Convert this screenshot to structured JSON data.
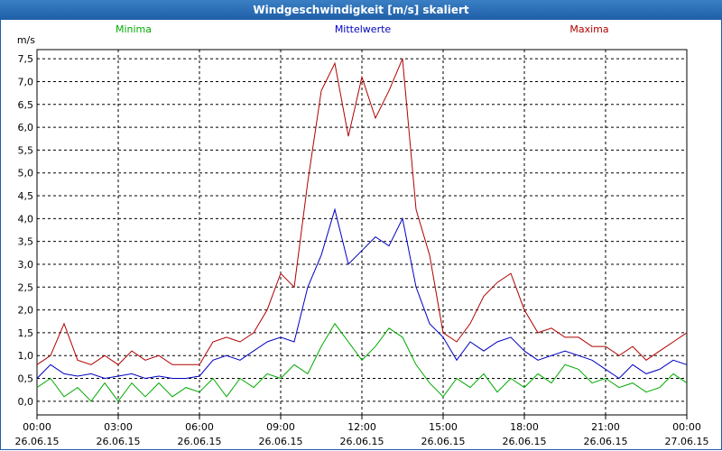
{
  "window": {
    "title": "Windgeschwindigkeit [m/s] skaliert"
  },
  "chart_data": {
    "type": "line",
    "title": "Windgeschwindigkeit [m/s] skaliert",
    "ylabel": "m/s",
    "xlabel": "",
    "ylim": [
      -0.3,
      7.7
    ],
    "xlim": [
      0,
      24
    ],
    "grid": true,
    "legend_position": "top",
    "y_ticks": [
      "0,0",
      "0,5",
      "1,0",
      "1,5",
      "2,0",
      "2,5",
      "3,0",
      "3,5",
      "4,0",
      "4,5",
      "5,0",
      "5,5",
      "6,0",
      "6,5",
      "7,0",
      "7,5"
    ],
    "y_tick_values": [
      0,
      0.5,
      1,
      1.5,
      2,
      2.5,
      3,
      3.5,
      4,
      4.5,
      5,
      5.5,
      6,
      6.5,
      7,
      7.5
    ],
    "x_ticks": [
      {
        "time": "00:00",
        "date": "26.06.15"
      },
      {
        "time": "03:00",
        "date": "26.06.15"
      },
      {
        "time": "06:00",
        "date": "26.06.15"
      },
      {
        "time": "09:00",
        "date": "26.06.15"
      },
      {
        "time": "12:00",
        "date": "26.06.15"
      },
      {
        "time": "15:00",
        "date": "26.06.15"
      },
      {
        "time": "18:00",
        "date": "26.06.15"
      },
      {
        "time": "21:00",
        "date": "26.06.15"
      },
      {
        "time": "00:00",
        "date": "27.06.15"
      }
    ],
    "x_tick_values": [
      0,
      3,
      6,
      9,
      12,
      15,
      18,
      21,
      24
    ],
    "x_unit": "hours",
    "series": [
      {
        "name": "Minima",
        "color": "#00aa00",
        "x": [
          0,
          0.5,
          1,
          1.5,
          2,
          2.5,
          3,
          3.5,
          4,
          4.5,
          5,
          5.5,
          6,
          6.5,
          7,
          7.5,
          8,
          8.5,
          9,
          9.5,
          10,
          10.5,
          11,
          11.5,
          12,
          12.5,
          13,
          13.5,
          14,
          14.5,
          15,
          15.5,
          16,
          16.5,
          17,
          17.5,
          18,
          18.5,
          19,
          19.5,
          20,
          20.5,
          21,
          21.5,
          22,
          22.5,
          23,
          23.5,
          24
        ],
        "values": [
          0.3,
          0.5,
          0.1,
          0.3,
          0,
          0.4,
          0,
          0.4,
          0.1,
          0.4,
          0.1,
          0.3,
          0.2,
          0.5,
          0.1,
          0.5,
          0.3,
          0.6,
          0.5,
          0.8,
          0.6,
          1.2,
          1.7,
          1.3,
          0.9,
          1.2,
          1.6,
          1.4,
          0.8,
          0.4,
          0.1,
          0.5,
          0.3,
          0.6,
          0.2,
          0.5,
          0.3,
          0.6,
          0.4,
          0.8,
          0.7,
          0.4,
          0.5,
          0.3,
          0.4,
          0.2,
          0.3,
          0.6,
          0.4
        ]
      },
      {
        "name": "Mittelwerte",
        "color": "#0000c0",
        "x": [
          0,
          0.5,
          1,
          1.5,
          2,
          2.5,
          3,
          3.5,
          4,
          4.5,
          5,
          5.5,
          6,
          6.5,
          7,
          7.5,
          8,
          8.5,
          9,
          9.5,
          10,
          10.5,
          11,
          11.5,
          12,
          12.5,
          13,
          13.5,
          14,
          14.5,
          15,
          15.5,
          16,
          16.5,
          17,
          17.5,
          18,
          18.5,
          19,
          19.5,
          20,
          20.5,
          21,
          21.5,
          22,
          22.5,
          23,
          23.5,
          24
        ],
        "values": [
          0.5,
          0.8,
          0.6,
          0.55,
          0.6,
          0.5,
          0.55,
          0.6,
          0.5,
          0.55,
          0.5,
          0.5,
          0.55,
          0.9,
          1.0,
          0.9,
          1.1,
          1.3,
          1.4,
          1.3,
          2.5,
          3.2,
          4.2,
          3.0,
          3.3,
          3.6,
          3.4,
          4.0,
          2.5,
          1.7,
          1.4,
          0.9,
          1.3,
          1.1,
          1.3,
          1.4,
          1.1,
          0.9,
          1.0,
          1.1,
          1.0,
          0.9,
          0.7,
          0.5,
          0.8,
          0.6,
          0.7,
          0.9,
          0.8
        ]
      },
      {
        "name": "Maxima",
        "color": "#b00000",
        "x": [
          0,
          0.5,
          1,
          1.5,
          2,
          2.5,
          3,
          3.5,
          4,
          4.5,
          5,
          5.5,
          6,
          6.5,
          7,
          7.5,
          8,
          8.5,
          9,
          9.5,
          10,
          10.5,
          11,
          11.5,
          12,
          12.5,
          13,
          13.5,
          14,
          14.5,
          15,
          15.5,
          16,
          16.5,
          17,
          17.5,
          18,
          18.5,
          19,
          19.5,
          20,
          20.5,
          21,
          21.5,
          22,
          22.5,
          23,
          23.5,
          24
        ],
        "values": [
          0.8,
          1.0,
          1.7,
          0.9,
          0.8,
          1.0,
          0.8,
          1.1,
          0.9,
          1.0,
          0.8,
          0.8,
          0.8,
          1.3,
          1.4,
          1.3,
          1.5,
          2.0,
          2.8,
          2.5,
          4.8,
          6.8,
          7.4,
          5.8,
          7.1,
          6.2,
          6.8,
          7.5,
          4.2,
          3.2,
          1.5,
          1.3,
          1.7,
          2.3,
          2.6,
          2.8,
          2.0,
          1.5,
          1.6,
          1.4,
          1.4,
          1.2,
          1.2,
          1.0,
          1.2,
          0.9,
          1.1,
          1.3,
          1.5
        ]
      }
    ]
  }
}
